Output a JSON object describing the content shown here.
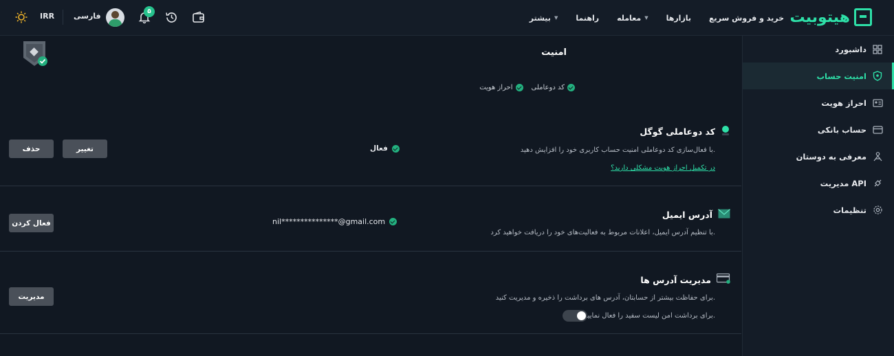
{
  "header": {
    "brand": "هیتوبیت",
    "nav": [
      {
        "label": "خرید و فروش سریع",
        "dropdown": false
      },
      {
        "label": "بازارها",
        "dropdown": false
      },
      {
        "label": "معامله",
        "dropdown": true
      },
      {
        "label": "راهنما",
        "dropdown": false
      },
      {
        "label": "بیشتر",
        "dropdown": true
      }
    ],
    "notification_count": "۵",
    "language": "فارسی",
    "currency": "IRR"
  },
  "sidebar": {
    "items": [
      {
        "label": "داشبورد",
        "icon": "grid-icon",
        "active": false
      },
      {
        "label": "امنیت حساب",
        "icon": "shield-icon",
        "active": true
      },
      {
        "label": "احراز هویت",
        "icon": "id-card-icon",
        "active": false
      },
      {
        "label": "حساب بانکی",
        "icon": "card-icon",
        "active": false
      },
      {
        "label": "معرفی به دوستان",
        "icon": "referral-icon",
        "active": false
      },
      {
        "label": "مدیریت API",
        "icon": "api-icon",
        "active": false
      },
      {
        "label": "تنظیمات",
        "icon": "gear-icon",
        "active": false
      }
    ]
  },
  "security": {
    "title": "امنیت",
    "status": [
      "کد دوعاملی",
      "احراز هویت"
    ]
  },
  "google_2fa": {
    "title": "کد دوعاملی گوگل",
    "description": "با فعال‌سازی کد دوعاملی امنیت حساب کاربری خود را افزایش دهید.",
    "link": "در تکمیل احراز هویت مشکلی دارید؟",
    "status": "فعال",
    "change_label": "تغییر",
    "delete_label": "حذف"
  },
  "email": {
    "title": "آدرس ایمیل",
    "description": "با تنظیم آدرس ایمیل، اعلانات مربوط به فعالیت‌های خود را دریافت خواهید کرد.",
    "value": "nil***************@gmail.com",
    "activate_label": "فعال کردن"
  },
  "addresses": {
    "title": "مدیریت آدرس ها",
    "description": "برای حفاظت بیشتر از حسابتان، آدرس های برداشت را ذخیره و مدیریت کنید.",
    "whitelist_text": "برای برداشت امن لیست سفید را فعال نمایید.",
    "manage_label": "مدیریت"
  },
  "colors": {
    "accent": "#2ee0a8",
    "background": "#111822",
    "button": "#4a5059"
  }
}
